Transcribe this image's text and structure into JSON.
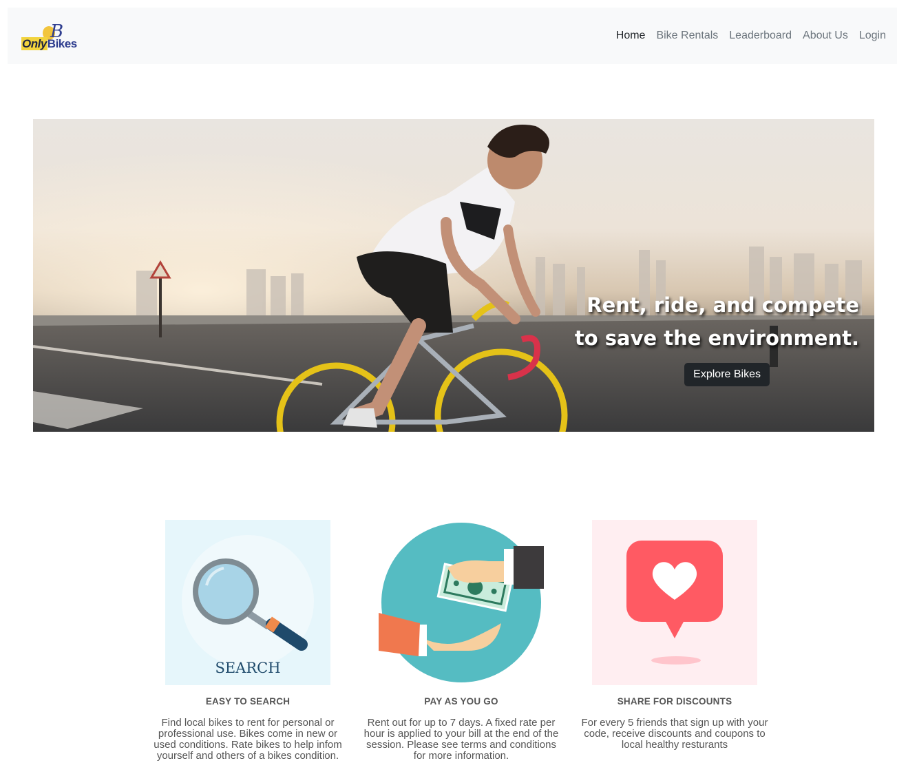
{
  "brand": {
    "logo_letter": "B",
    "logo_only": "Only",
    "logo_bikes": "Bikes"
  },
  "nav": {
    "items": [
      {
        "label": "Home",
        "active": true
      },
      {
        "label": "Bike Rentals",
        "active": false
      },
      {
        "label": "Leaderboard",
        "active": false
      },
      {
        "label": "About Us",
        "active": false
      },
      {
        "label": "Login",
        "active": false
      }
    ]
  },
  "hero": {
    "title_line1": "Rent, ride, and compete",
    "title_line2": "to save the environment.",
    "button_label": "Explore Bikes"
  },
  "features": [
    {
      "image_text": "SEARCH",
      "icon": "magnifying-glass-icon",
      "title": "EASY TO SEARCH",
      "text": "Find local bikes to rent for personal or professional use. Bikes come in new or used conditions. Rate bikes to help infom yourself and others of a bikes condition."
    },
    {
      "icon": "money-exchange-icon",
      "title": "PAY AS YOU GO",
      "text": "Rent out for up to 7 days. A fixed rate per hour is applied to your bill at the end of the session. Please see terms and conditions for more information."
    },
    {
      "icon": "heart-notification-icon",
      "title": "SHARE FOR DISCOUNTS",
      "text": "For every 5 friends that sign up with your code, receive discounts and coupons to local healthy resturants"
    }
  ],
  "colors": {
    "navbar_bg": "#f8f9fa",
    "button_bg": "#212529",
    "search_bg": "#e6f6fb",
    "pay_circle": "#55bcc2",
    "share_bg": "#ffeef1",
    "heart_red": "#ff5a63"
  }
}
